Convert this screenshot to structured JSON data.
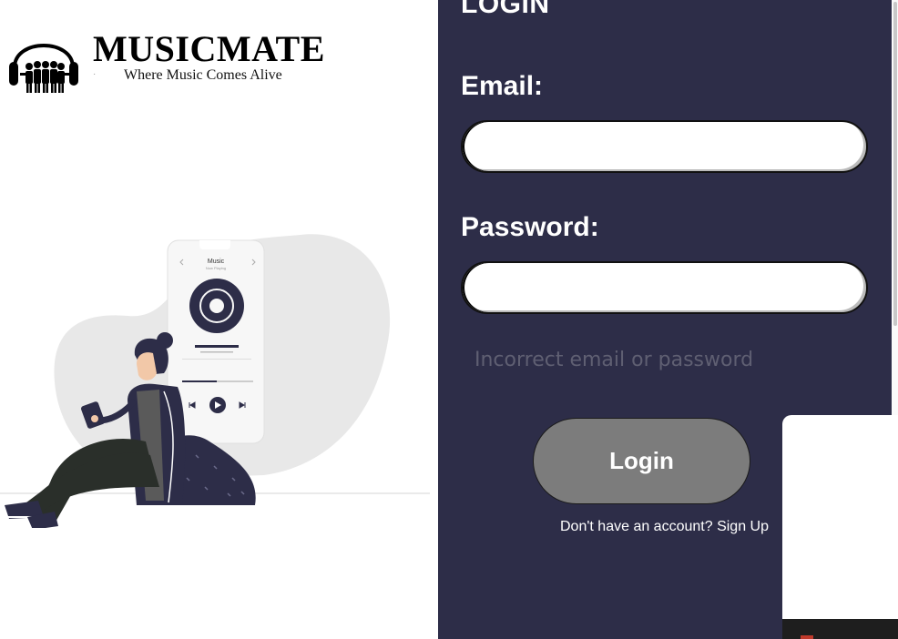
{
  "brand": {
    "title": "MUSICMATE",
    "tagline": "Where Music Comes Alive",
    "logo_icon": "headphones-people-icon"
  },
  "illustration": {
    "phone_title": "Music",
    "phone_subtitle": "Now Playing",
    "icon": "woman-listening-music-illustration"
  },
  "login": {
    "heading": "LOGIN",
    "email_label": "Email:",
    "email_value": "",
    "password_label": "Password:",
    "password_value": "",
    "error_message": "Incorrect email or password",
    "login_button": "Login",
    "signup_prompt": "Don't have an account?",
    "signup_link": "Sign Up"
  },
  "colors": {
    "panel_bg": "#2d2d48",
    "button_bg": "#7c7c7c",
    "error_text": "#5f5f72"
  }
}
